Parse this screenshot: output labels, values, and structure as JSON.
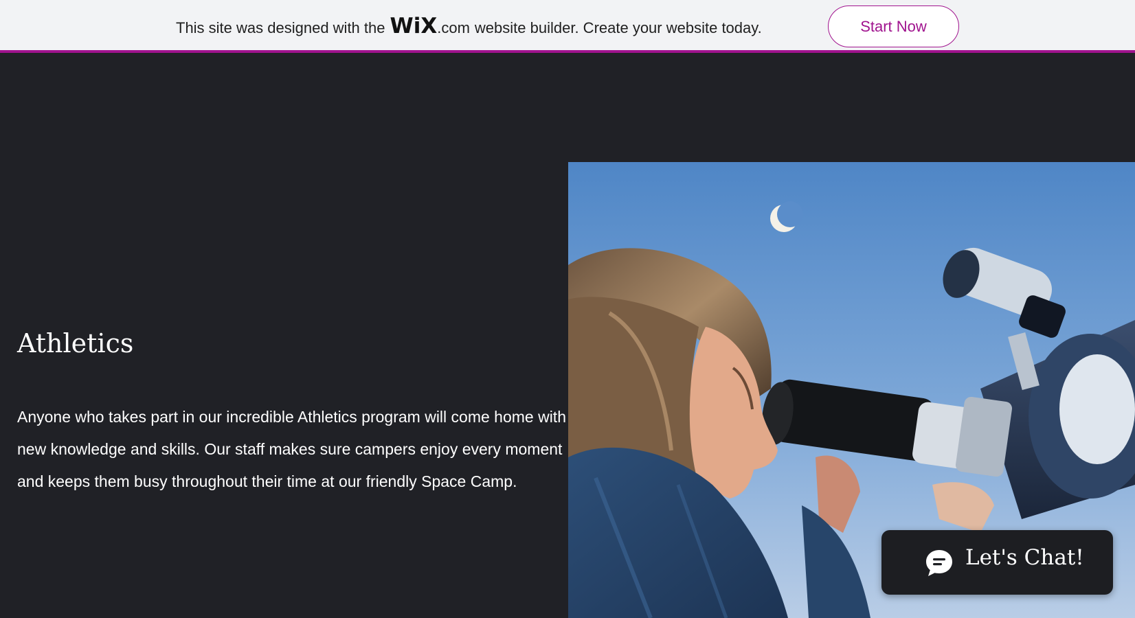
{
  "banner": {
    "text_before_logo": "This site was designed with the",
    "logo": "WiX",
    "text_after_logo": ".com",
    "text_tail": "website builder. Create your website today.",
    "cta_label": "Start Now",
    "accent_color": "#a0138e"
  },
  "section": {
    "heading": "Athletics",
    "body": "Anyone who takes part in our incredible Athletics program will come home with new knowledge and skills. Our staff makes sure campers enjoy every moment and keeps them busy throughout their time at our friendly Space Camp."
  },
  "chat": {
    "label": "Let's Chat!",
    "icon": "chat-bubble-icon"
  },
  "colors": {
    "page_background": "#202126",
    "banner_background": "#f2f3f5"
  }
}
